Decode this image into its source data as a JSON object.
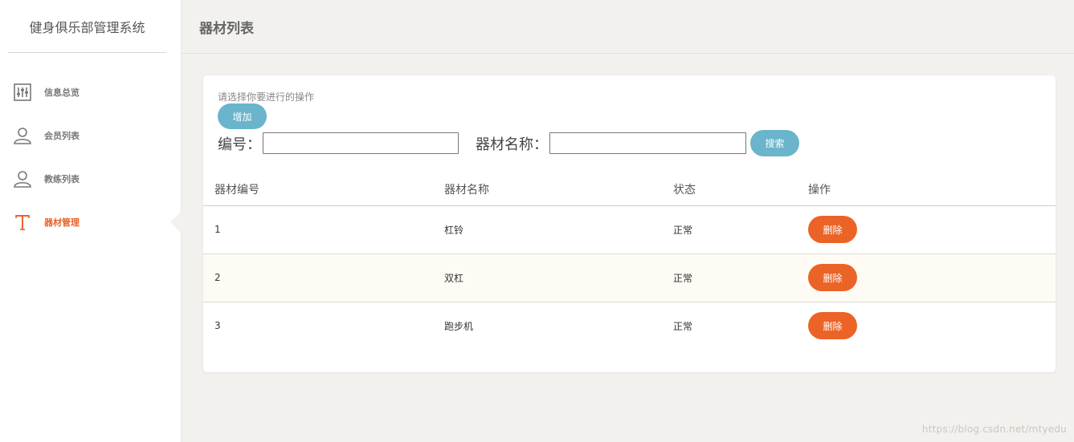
{
  "app": {
    "title": "健身俱乐部管理系统"
  },
  "sidebar": {
    "items": [
      {
        "label": "信息总览",
        "icon": "sliders-icon",
        "active": false
      },
      {
        "label": "会员列表",
        "icon": "user-icon",
        "active": false
      },
      {
        "label": "教练列表",
        "icon": "user-icon",
        "active": false
      },
      {
        "label": "器材管理",
        "icon": "text-t-icon",
        "active": true
      }
    ]
  },
  "header": {
    "title": "器材列表"
  },
  "main": {
    "hint": "请选择你要进行的操作",
    "add_label": "增加",
    "search": {
      "id_label": "编号：",
      "id_value": "",
      "name_label": "器材名称：",
      "name_value": "",
      "button_label": "搜索"
    },
    "table": {
      "headers": [
        "器材编号",
        "器材名称",
        "状态",
        "操作"
      ],
      "rows": [
        {
          "id": "1",
          "name": "杠铃",
          "status": "正常",
          "action": "删除"
        },
        {
          "id": "2",
          "name": "双杠",
          "status": "正常",
          "action": "删除"
        },
        {
          "id": "3",
          "name": "跑步机",
          "status": "正常",
          "action": "删除"
        }
      ]
    }
  },
  "watermark": "https://blog.csdn.net/mtyedu",
  "colors": {
    "accent_blue": "#6ab4cc",
    "accent_orange": "#ec6327",
    "active_nav": "#e8632b",
    "background": "#f2f1ee"
  }
}
